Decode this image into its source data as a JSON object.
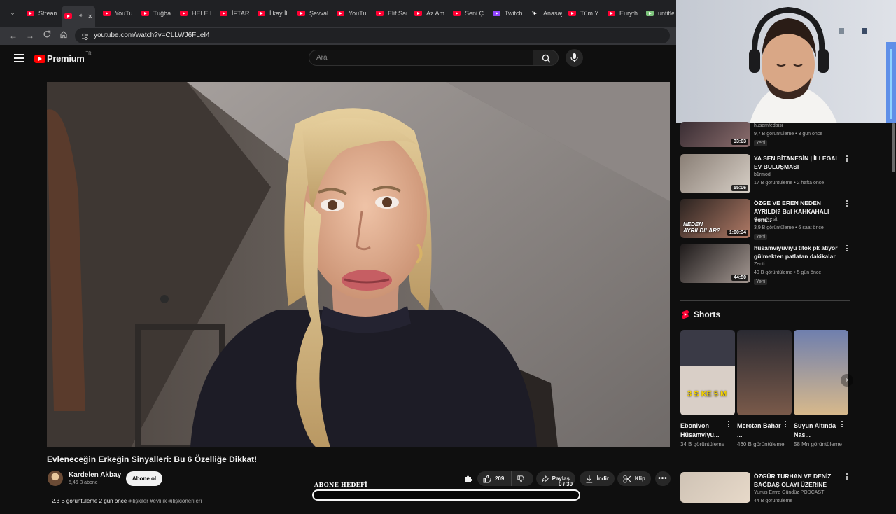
{
  "browser": {
    "tabs": [
      {
        "label": "Stream",
        "icon": "youtube-icon"
      },
      {
        "label": "",
        "icon": "youtube-icon",
        "active": true
      },
      {
        "label": "YouTu",
        "icon": "youtube-icon"
      },
      {
        "label": "Tuğba",
        "icon": "youtube-icon"
      },
      {
        "label": "HELE B",
        "icon": "youtube-icon"
      },
      {
        "label": "İFTAR",
        "icon": "youtube-icon"
      },
      {
        "label": "İlkay İl",
        "icon": "youtube-icon"
      },
      {
        "label": "Şevval",
        "icon": "youtube-icon"
      },
      {
        "label": "YouTu",
        "icon": "youtube-icon"
      },
      {
        "label": "Elif Sar",
        "icon": "youtube-icon"
      },
      {
        "label": "Az Am",
        "icon": "youtube-icon"
      },
      {
        "label": "Seni Ç",
        "icon": "youtube-icon"
      },
      {
        "label": "Twitch",
        "icon": "twitch-icon"
      },
      {
        "label": "Anasay",
        "icon": "x-icon"
      },
      {
        "label": "Tüm Y",
        "icon": "youtube-icon"
      },
      {
        "label": "Euryth",
        "icon": "youtube-icon"
      },
      {
        "label": "untitle",
        "icon": "document-icon"
      }
    ],
    "url": "youtube.com/watch?v=CLLWJ6FLeI4"
  },
  "masthead": {
    "logo_text": "Premium",
    "region": "TR",
    "search_placeholder": "Ara"
  },
  "video": {
    "title": "Evleneceğin Erkeğin Sinyalleri: Bu 6 Özelliğe Dikkat!",
    "channel": "Kardelen Akbay",
    "subscribers": "5,46 B abone",
    "subscribe_label": "Abone ol",
    "likes": "209",
    "share_label": "Paylaş",
    "download_label": "İndir",
    "clip_label": "Klip",
    "desc_stats": "2,3 B görüntüleme  2 gün önce",
    "desc_tags": "#ilişkiler #evlilik #ilişkiönerileri"
  },
  "goal": {
    "label": "ABONE HEDEFİ",
    "count": "0 / 30",
    "progress": 0
  },
  "recommendations": [
    {
      "title": "",
      "channel": "husamfedaisi",
      "meta": "9,7 B görüntüleme • 3 gün önce",
      "badge": "Yeni",
      "duration": "33:03"
    },
    {
      "title": "YA SEN BİTANESİN | İLLEGAL EV BULUŞMASI",
      "channel": "b1rmod",
      "meta": "17 B görüntüleme • 2 hafta önce",
      "badge": "",
      "duration": "55:06"
    },
    {
      "title": "ÖZGE VE EREN NEDEN AYRILDI? Bol KAHKAHALI Yeni...",
      "channel": "Cavs Kesit",
      "meta": "3,9 B görüntüleme • 6 saat önce",
      "badge": "Yeni",
      "duration": "1:00:34",
      "thumb_text": "NEDEN AYRILDILAR?"
    },
    {
      "title": "husamviyuviyu titok pk atıyor gülmekten patlatan dakikalar",
      "channel": "Zenti",
      "meta": "40 B görüntüleme • 5 gün önce",
      "badge": "Yeni",
      "duration": "44:50"
    },
    {
      "title": "ÖZGÜR TURHAN VE DENİZ BAĞDAŞ OLAYI ÜZERİNE",
      "channel": "Yunus Emre Gündüz PODCAST",
      "meta": "44 B görüntüleme",
      "badge": "",
      "duration": ""
    }
  ],
  "shorts": {
    "heading": "Shorts",
    "items": [
      {
        "title": "Ebonivon Hüsamviyu...",
        "views": "34 B görüntüleme",
        "thumb_text": "3 S KE 5 M"
      },
      {
        "title": "Merctan Bahar ...",
        "views": "460 B görüntüleme",
        "thumb_text": ""
      },
      {
        "title": "Suyun Altında Nas...",
        "views": "58 Mn görüntüleme",
        "thumb_text": ""
      }
    ]
  },
  "colors": {
    "youtube_red": "#ff0000",
    "background": "#0f0f0f",
    "pill": "#272727"
  }
}
